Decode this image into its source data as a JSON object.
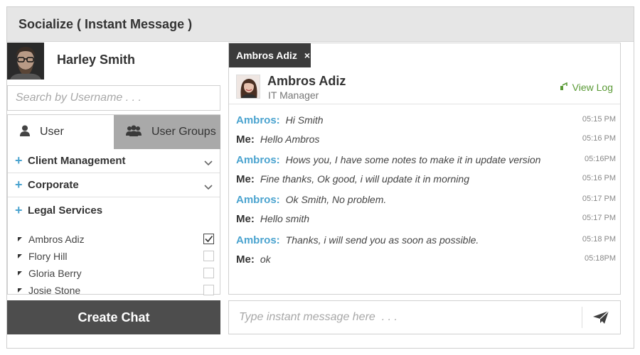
{
  "window": {
    "title": "Socialize ( Instant Message )"
  },
  "profile": {
    "name": "Harley Smith"
  },
  "search": {
    "placeholder": "Search by Username . . ."
  },
  "tabs": [
    {
      "label": "User",
      "icon": "user-icon",
      "active": true
    },
    {
      "label": "User Groups",
      "icon": "users-group-icon",
      "active": false
    }
  ],
  "categories": [
    {
      "label": "Client Management",
      "icon": "plus-icon",
      "expanded": false
    },
    {
      "label": "Corporate",
      "icon": "plus-icon",
      "expanded": false
    },
    {
      "label": "Legal Services",
      "icon": "plus-icon",
      "expanded": true
    }
  ],
  "members": [
    {
      "name": "Ambros Adiz",
      "checked": true
    },
    {
      "name": "Flory Hill",
      "checked": false
    },
    {
      "name": "Gloria Berry",
      "checked": false
    },
    {
      "name": "Josie Stone",
      "checked": false
    }
  ],
  "create_chat": {
    "label": "Create Chat"
  },
  "chat": {
    "tab_label": "Ambros Adiz",
    "tab_close": "×",
    "contact_name": "Ambros Adiz",
    "contact_role": "IT Manager",
    "view_log": "View Log",
    "messages": [
      {
        "sender": "Ambros:",
        "from_me": false,
        "text": "Hi Smith",
        "time": "05:15 PM"
      },
      {
        "sender": "Me:",
        "from_me": true,
        "text": "Hello Ambros",
        "time": "05:16 PM"
      },
      {
        "sender": "Ambros:",
        "from_me": false,
        "text": "Hows you, I have some notes to make it in update version",
        "time": "05:16PM"
      },
      {
        "sender": "Me:",
        "from_me": true,
        "text": "Fine thanks, Ok good, i will update it in morning",
        "time": "05:16 PM"
      },
      {
        "sender": "Ambros:",
        "from_me": false,
        "text": "Ok Smith, No problem.",
        "time": "05:17 PM"
      },
      {
        "sender": "Me:",
        "from_me": true,
        "text": "Hello smith",
        "time": "05:17 PM"
      },
      {
        "sender": "Ambros:",
        "from_me": false,
        "text": "Thanks, i will send you as soon as possible.",
        "time": "05:18 PM"
      },
      {
        "sender": "Me:",
        "from_me": true,
        "text": "ok",
        "time": "05:18PM"
      }
    ]
  },
  "composer": {
    "placeholder": "Type instant message here  . . .",
    "send_icon": "send-icon"
  },
  "colors": {
    "accent_blue": "#4aa3cf",
    "accent_green": "#5a9a36",
    "dark_button": "#4d4d4d",
    "titlebar": "#e6e6e6",
    "tab_inactive": "#a9a9a9"
  }
}
